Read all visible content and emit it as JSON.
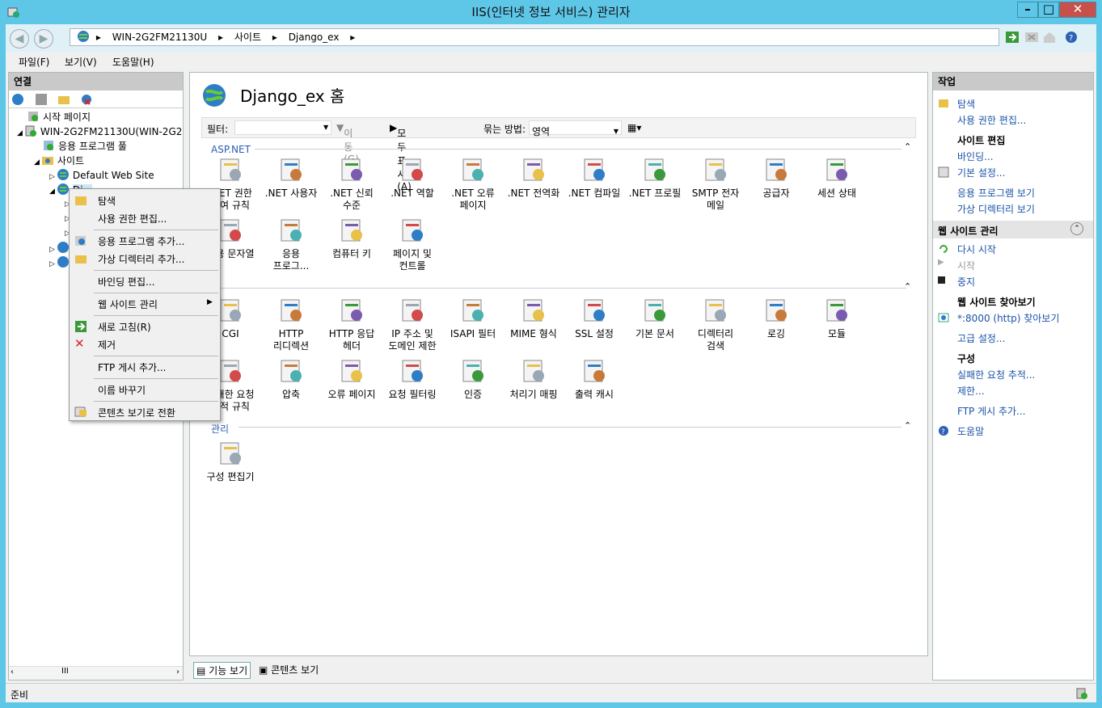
{
  "window": {
    "title": "IIS(인터넷 정보 서비스) 관리자"
  },
  "address": {
    "crumbs": [
      "WIN-2G2FM21130U",
      "사이트",
      "Django_ex"
    ]
  },
  "menu": {
    "file": "파일(F)",
    "view": "보기(V)",
    "help": "도움말(H)"
  },
  "connections": {
    "title": "연결",
    "tree": {
      "start_page": "시작 페이지",
      "server": "WIN-2G2FM21130U(WIN-2G2FM",
      "app_pools": "응용 프로그램 풀",
      "sites": "사이트",
      "default_site": "Default Web Site",
      "selected_site": "Dj..."
    }
  },
  "center": {
    "title": "Django_ex 홈",
    "filter_label": "필터:",
    "go": "이동(G)",
    "show_all": "모두 표시(A)",
    "group_by_label": "묶는 방법:",
    "group_by_value": "영역",
    "group_aspnet": "ASP.NET",
    "group_manage": "관리",
    "aspnet_features": [
      ".NET 권한\n부여 규칙",
      ".NET 사용자",
      ".NET 신뢰\n수준",
      ".NET 역할",
      ".NET 오류\n페이지",
      ".NET 전역화",
      ".NET 컴파일",
      ".NET 프로필",
      "SMTP 전자\n메일",
      "공급자",
      "세션 상태",
      "응용 문자열",
      "응용\n프로그...",
      "컴퓨터 키",
      "페이지 및\n컨트롤"
    ],
    "iis_features": [
      "CGI",
      "HTTP\n리디렉션",
      "HTTP 응답\n헤더",
      "IP 주소 및\n도메인 제한",
      "ISAPI 필터",
      "MIME 형식",
      "SSL 설정",
      "기본 문서",
      "디렉터리\n검색",
      "로깅",
      "모듈",
      "실패한 요청\n추적 규칙",
      "압축",
      "오류 페이지",
      "요청 필터링",
      "인증",
      "처리기 매핑",
      "출력 캐시"
    ],
    "manage_features": [
      "구성 편집기"
    ],
    "tab_features": "기능 보기",
    "tab_content": "콘텐츠 보기"
  },
  "actions": {
    "title": "작업",
    "explore": "탐색",
    "edit_permissions": "사용 권한 편집...",
    "edit_site_h": "사이트 편집",
    "bindings": "바인딩...",
    "basic_settings": "기본 설정...",
    "view_apps": "응용 프로그램 보기",
    "view_vdirs": "가상 디렉터리 보기",
    "manage_site_h": "웹 사이트 관리",
    "restart": "다시 시작",
    "start": "시작",
    "stop": "중지",
    "browse_h": "웹 사이트 찾아보기",
    "browse_8000": "*:8000 (http) 찾아보기",
    "advanced": "고급 설정...",
    "config_h": "구성",
    "failed_req": "실패한 요청 추적...",
    "limits": "제한...",
    "add_ftp": "FTP 게시 추가...",
    "help": "도움말"
  },
  "context_menu": {
    "explore": "탐색",
    "edit_permissions": "사용 권한 편집...",
    "add_app": "응용 프로그램 추가...",
    "add_vdir": "가상 디렉터리 추가...",
    "edit_bindings": "바인딩 편집...",
    "manage_site": "웹 사이트 관리",
    "refresh": "새로 고침(R)",
    "remove": "제거",
    "add_ftp": "FTP 게시 추가...",
    "rename": "이름 바꾸기",
    "switch_content": "콘텐츠 보기로 전환"
  },
  "status": {
    "text": "준비"
  }
}
